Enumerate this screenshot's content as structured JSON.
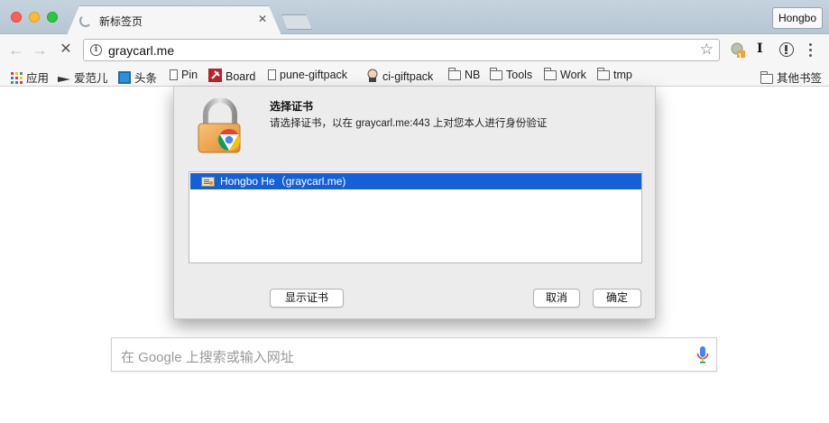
{
  "tab": {
    "title": "新标签页",
    "close": "✕"
  },
  "profile": {
    "label": "Hongbo"
  },
  "toolbar": {
    "back": "←",
    "forward": "→",
    "stop": "✕",
    "url": "graycarl.me",
    "info": "i",
    "star": "☆",
    "ext_badge": "1",
    "ext_i": "I"
  },
  "bookmarks": {
    "items": [
      {
        "label": "应用",
        "icon": "apps-grid-icon"
      },
      {
        "label": "爱范儿",
        "icon": "ifanr-icon"
      },
      {
        "label": "头条",
        "icon": "toutiao-icon"
      },
      {
        "label": "Pin",
        "icon": "page-icon"
      },
      {
        "label": "Board",
        "icon": "pin-board-icon"
      },
      {
        "label": "pune-giftpack",
        "icon": "page-icon"
      },
      {
        "label": "ci-giftpack",
        "icon": "jenkins-icon"
      },
      {
        "label": "NB",
        "icon": "folder-icon"
      },
      {
        "label": "Tools",
        "icon": "folder-icon"
      },
      {
        "label": "Work",
        "icon": "folder-icon"
      },
      {
        "label": "tmp",
        "icon": "folder-icon"
      }
    ],
    "other": "其他书签"
  },
  "dialog": {
    "title": "选择证书",
    "message": "请选择证书，以在 graycarl.me:443 上对您本人进行身份验证",
    "certificate": "Hongbo He（graycarl.me)",
    "show_cert": "显示证书",
    "cancel": "取消",
    "ok": "确定"
  },
  "search": {
    "placeholder": "在 Google 上搜索或输入网址"
  },
  "colors": {
    "selection": "#1560d6",
    "tab_bar": "#c5d3de"
  }
}
